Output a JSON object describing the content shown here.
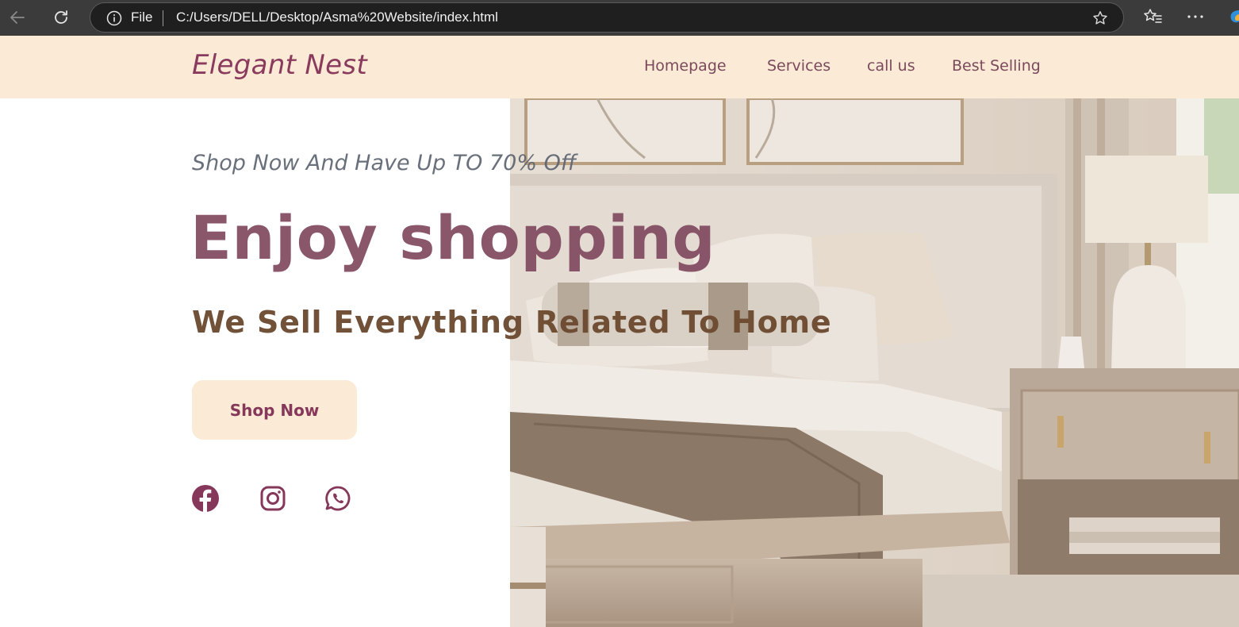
{
  "browser": {
    "file_label": "File",
    "url": "C:/Users/DELL/Desktop/Asma%20Website/index.html",
    "icons": [
      "back-icon",
      "reload-icon",
      "info-icon",
      "star-icon",
      "favorites-icon",
      "more-icon",
      "copilot-icon"
    ]
  },
  "header": {
    "logo": "Elegant Nest",
    "nav": {
      "home": "Homepage",
      "services": "Services",
      "call": "call us",
      "best": "Best Selling"
    }
  },
  "hero": {
    "subtitle": "Shop Now And Have Up TO 70% Off",
    "headline": "Enjoy shopping",
    "tagline": "We Sell Everything Related To Home",
    "button": "Shop Now",
    "image_alt": "bedroom-photo"
  },
  "social": [
    "facebook-icon",
    "instagram-icon",
    "whatsapp-icon"
  ],
  "colors": {
    "header_bg": "#fbead6",
    "brand": "#8a3b5d",
    "headline": "#834d63",
    "tagline": "#6c4a30",
    "subtitle": "#5d6470"
  }
}
